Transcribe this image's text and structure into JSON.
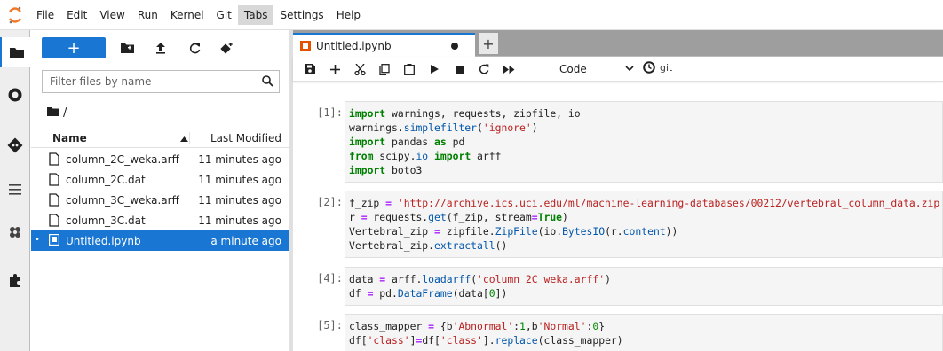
{
  "menubar": {
    "items": [
      "File",
      "Edit",
      "View",
      "Run",
      "Kernel",
      "Git",
      "Tabs",
      "Settings",
      "Help"
    ],
    "active": "Tabs"
  },
  "activity_bar": {
    "icons": [
      "folder-icon",
      "running-kernels-icon",
      "git-icon",
      "table-of-contents-icon",
      "extension-brain-icon",
      "extension-manager-icon"
    ]
  },
  "file_browser": {
    "new_launcher_label": "+",
    "filter_placeholder": "Filter files by name",
    "filter_value": "",
    "breadcrumb": "/",
    "header_name": "Name",
    "header_modified": "Last Modified",
    "files": [
      {
        "name": "column_2C_weka.arff",
        "modified": "11 minutes ago",
        "selected": false,
        "kind": "file"
      },
      {
        "name": "column_2C.dat",
        "modified": "11 minutes ago",
        "selected": false,
        "kind": "file"
      },
      {
        "name": "column_3C_weka.arff",
        "modified": "11 minutes ago",
        "selected": false,
        "kind": "file"
      },
      {
        "name": "column_3C.dat",
        "modified": "11 minutes ago",
        "selected": false,
        "kind": "file"
      },
      {
        "name": "Untitled.ipynb",
        "modified": "a minute ago",
        "selected": true,
        "kind": "notebook",
        "running": "•"
      }
    ]
  },
  "notebook": {
    "tab_title": "Untitled.ipynb",
    "new_tab_label": "+",
    "cell_type": "Code",
    "git_label": "git",
    "cells": [
      {
        "prompt": "[1]:",
        "lines": [
          "import warnings, requests, zipfile, io",
          "warnings.simplefilter('ignore')",
          "import pandas as pd",
          "from scipy.io import arff",
          "import boto3"
        ]
      },
      {
        "prompt": "[2]:",
        "lines": [
          "f_zip = 'http://archive.ics.uci.edu/ml/machine-learning-databases/00212/vertebral_column_data.zip'",
          "r = requests.get(f_zip, stream=True)",
          "Vertebral_zip = zipfile.ZipFile(io.BytesIO(r.content))",
          "Vertebral_zip.extractall()"
        ]
      },
      {
        "prompt": "[4]:",
        "lines": [
          "data = arff.loadarff('column_2C_weka.arff')",
          "df = pd.DataFrame(data[0])"
        ]
      },
      {
        "prompt": "[5]:",
        "lines": [
          "class_mapper = {b'Abnormal':1,b'Normal':0}",
          "df['class']=df['class'].replace(class_mapper)"
        ]
      }
    ]
  },
  "colors": {
    "accent": "#1976d2",
    "selected_row": "#1976d2",
    "notebook_icon": "#e65100"
  }
}
